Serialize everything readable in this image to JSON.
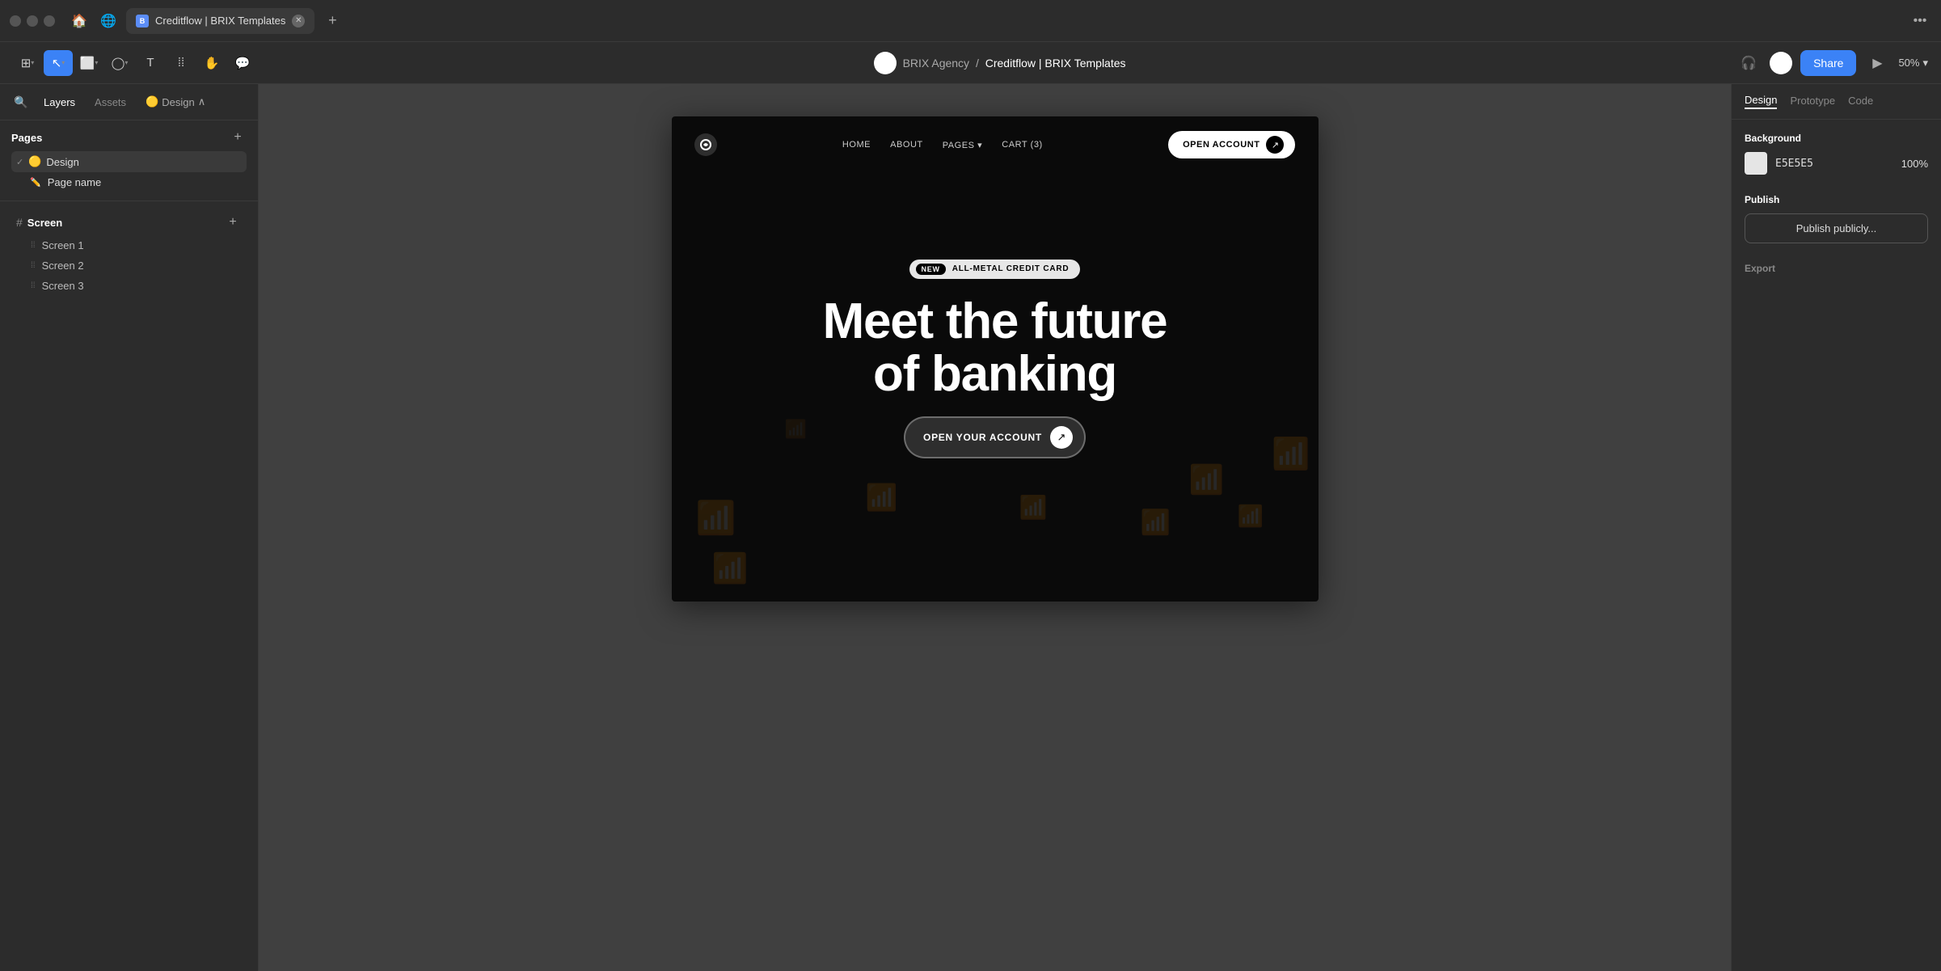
{
  "titlebar": {
    "tab_title": "Creditflow | BRIX Templates",
    "tab_favicon": "B",
    "more_label": "•••"
  },
  "toolbar": {
    "tools": [
      {
        "id": "grid",
        "symbol": "⊞",
        "active": false,
        "has_arrow": true
      },
      {
        "id": "select",
        "symbol": "↖",
        "active": true,
        "has_arrow": true
      },
      {
        "id": "frame",
        "symbol": "⬜",
        "active": false,
        "has_arrow": true
      },
      {
        "id": "shape",
        "symbol": "◯",
        "active": false,
        "has_arrow": true
      },
      {
        "id": "text",
        "symbol": "T",
        "active": false,
        "has_arrow": false
      },
      {
        "id": "components",
        "symbol": "⁞⁞",
        "active": false,
        "has_arrow": false
      },
      {
        "id": "hand",
        "symbol": "✋",
        "active": false,
        "has_arrow": false
      },
      {
        "id": "comment",
        "symbol": "💬",
        "active": false,
        "has_arrow": false
      }
    ],
    "project_agency": "BRIX Agency",
    "project_separator": "/",
    "project_name": "Creditflow | BRIX Templates",
    "share_label": "Share",
    "zoom_label": "50%"
  },
  "left_panel": {
    "tabs": {
      "layers": "Layers",
      "assets": "Assets",
      "design": "🟡 Design"
    },
    "pages_title": "Pages",
    "pages": [
      {
        "name": "🟡 Design",
        "active": true,
        "check": "✓"
      },
      {
        "name": "Page name",
        "active": false,
        "edit_icon": "✏️"
      }
    ],
    "screens_title": "Screen",
    "screens": [
      {
        "name": "Screen 1",
        "active": false
      },
      {
        "name": "Screen 2",
        "active": false
      },
      {
        "name": "Screen 3",
        "active": false
      }
    ]
  },
  "canvas": {
    "webpage": {
      "nav": {
        "links": [
          "HOME",
          "ABOUT",
          "PAGES",
          "CART (3)"
        ],
        "pages_has_arrow": true,
        "cta_text": "OPEN ACCOUNT",
        "cta_arrow": "↗"
      },
      "hero": {
        "badge_new": "NEW",
        "badge_text": "ALL-METAL CREDIT CARD",
        "title_line1": "Meet the future",
        "title_line2": "of banking",
        "cta_text": "OPEN YOUR ACCOUNT",
        "cta_arrow": "↗"
      }
    }
  },
  "right_panel": {
    "tabs": [
      "Design",
      "Prototype",
      "Code"
    ],
    "active_tab": "Design",
    "background_title": "Background",
    "background_color": "E5E5E5",
    "background_opacity": "100%",
    "publish_title": "Publish",
    "publish_btn_label": "Publish publicly...",
    "export_title": "Export"
  }
}
